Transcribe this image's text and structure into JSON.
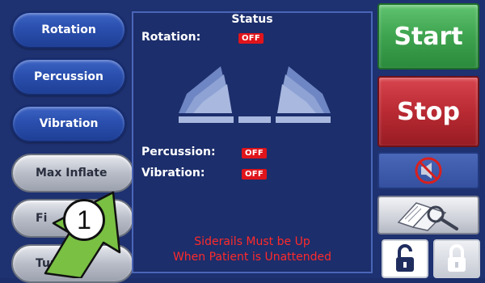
{
  "left_menu": {
    "rotation": "Rotation",
    "percussion": "Percussion",
    "vibration": "Vibration",
    "max_inflate": "Max Inflate",
    "fi_partial": "Fi",
    "turn_partial": "Turn A"
  },
  "status_panel": {
    "title": "Status",
    "rotation_label": "Rotation:",
    "rotation_value": "OFF",
    "percussion_label": "Percussion:",
    "percussion_value": "OFF",
    "vibration_label": "Vibration:",
    "vibration_value": "OFF",
    "warning_line1": "Siderails Must be Up",
    "warning_line2": "When Patient is Unattended"
  },
  "right_controls": {
    "start": "Start",
    "stop": "Stop"
  },
  "annotation": {
    "number": "1"
  },
  "colors": {
    "background": "#1e3170",
    "start": "#3ea34f",
    "stop": "#b92a33",
    "off_badge": "#e0141b",
    "warning": "#ff2a2a"
  },
  "icons": {
    "mute": "no-sound-icon",
    "manual": "manual-magnifier-icon",
    "unlock": "unlock-icon",
    "lock": "lock-icon"
  }
}
